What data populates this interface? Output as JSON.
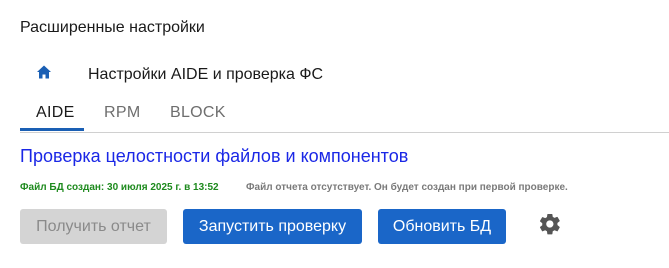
{
  "page": {
    "title": "Расширенные настройки"
  },
  "breadcrumb": {
    "icon": "home-icon",
    "label": "Настройки AIDE и проверка ФС"
  },
  "tabs": [
    {
      "label": "AIDE",
      "active": true
    },
    {
      "label": "RPM",
      "active": false
    },
    {
      "label": "BLOCK",
      "active": false
    }
  ],
  "section": {
    "title": "Проверка целостности файлов и компонентов"
  },
  "status": {
    "db_created": "Файл БД создан: 30 июля 2025 г. в 13:52",
    "report_missing": "Файл отчета отсутствует. Он будет создан при первой проверке."
  },
  "actions": {
    "get_report": "Получить отчет",
    "run_check": "Запустить проверку",
    "update_db": "Обновить БД",
    "settings_icon": "gear-icon"
  },
  "colors": {
    "accent": "#1a66c8",
    "link": "#1a27e6",
    "success": "#1d8a1d",
    "muted": "#7a7a7a",
    "disabled": "#d4d4d4"
  }
}
